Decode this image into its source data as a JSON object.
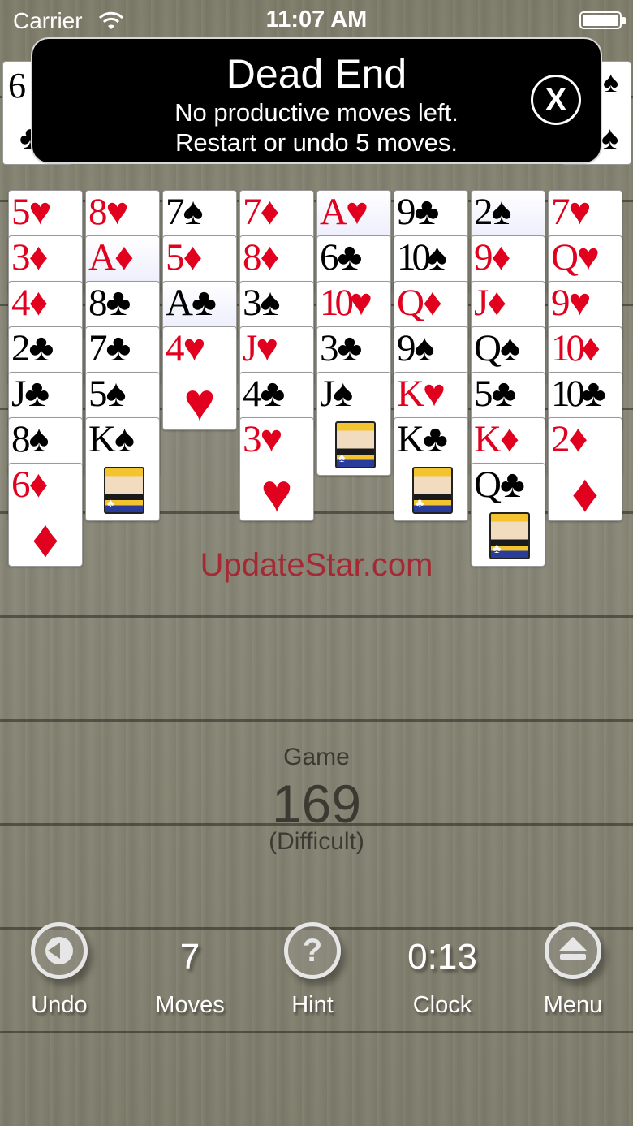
{
  "status_bar": {
    "carrier": "Carrier",
    "time": "11:07 AM"
  },
  "freecells": {
    "left": {
      "rank": "6",
      "suit": "♣",
      "color": "black"
    },
    "right": {
      "rank": "",
      "suit": "♠",
      "color": "black"
    }
  },
  "dialog": {
    "title": "Dead End",
    "line1": "No productive moves left.",
    "line2": "Restart or undo 5 moves.",
    "close_label": "X"
  },
  "tableau": [
    {
      "cards": [
        {
          "rank": "5",
          "suit": "♥",
          "color": "red"
        },
        {
          "rank": "3",
          "suit": "♦",
          "color": "red"
        },
        {
          "rank": "4",
          "suit": "♦",
          "color": "red"
        },
        {
          "rank": "2",
          "suit": "♣",
          "color": "black"
        },
        {
          "rank": "J",
          "suit": "♣",
          "color": "black"
        },
        {
          "rank": "8",
          "suit": "♠",
          "color": "black"
        },
        {
          "rank": "6",
          "suit": "♦",
          "color": "red"
        }
      ]
    },
    {
      "cards": [
        {
          "rank": "8",
          "suit": "♥",
          "color": "red"
        },
        {
          "rank": "A",
          "suit": "♦",
          "color": "red",
          "highlight": true
        },
        {
          "rank": "8",
          "suit": "♣",
          "color": "black"
        },
        {
          "rank": "7",
          "suit": "♣",
          "color": "black"
        },
        {
          "rank": "5",
          "suit": "♠",
          "color": "black"
        },
        {
          "rank": "K",
          "suit": "♠",
          "color": "black"
        }
      ]
    },
    {
      "cards": [
        {
          "rank": "7",
          "suit": "♠",
          "color": "black"
        },
        {
          "rank": "5",
          "suit": "♦",
          "color": "red"
        },
        {
          "rank": "A",
          "suit": "♣",
          "color": "black",
          "highlight": true
        },
        {
          "rank": "4",
          "suit": "♥",
          "color": "red"
        }
      ]
    },
    {
      "cards": [
        {
          "rank": "7",
          "suit": "♦",
          "color": "red"
        },
        {
          "rank": "8",
          "suit": "♦",
          "color": "red"
        },
        {
          "rank": "3",
          "suit": "♠",
          "color": "black"
        },
        {
          "rank": "J",
          "suit": "♥",
          "color": "red"
        },
        {
          "rank": "4",
          "suit": "♣",
          "color": "black"
        },
        {
          "rank": "3",
          "suit": "♥",
          "color": "red"
        }
      ]
    },
    {
      "cards": [
        {
          "rank": "A",
          "suit": "♥",
          "color": "red",
          "highlight": true
        },
        {
          "rank": "6",
          "suit": "♣",
          "color": "black"
        },
        {
          "rank": "10",
          "suit": "♥",
          "color": "red"
        },
        {
          "rank": "3",
          "suit": "♣",
          "color": "black"
        },
        {
          "rank": "J",
          "suit": "♠",
          "color": "black"
        }
      ]
    },
    {
      "cards": [
        {
          "rank": "9",
          "suit": "♣",
          "color": "black"
        },
        {
          "rank": "10",
          "suit": "♠",
          "color": "black"
        },
        {
          "rank": "Q",
          "suit": "♦",
          "color": "red"
        },
        {
          "rank": "9",
          "suit": "♠",
          "color": "black"
        },
        {
          "rank": "K",
          "suit": "♥",
          "color": "red"
        },
        {
          "rank": "K",
          "suit": "♣",
          "color": "black"
        }
      ]
    },
    {
      "cards": [
        {
          "rank": "2",
          "suit": "♠",
          "color": "black",
          "highlight": true
        },
        {
          "rank": "9",
          "suit": "♦",
          "color": "red"
        },
        {
          "rank": "J",
          "suit": "♦",
          "color": "red"
        },
        {
          "rank": "Q",
          "suit": "♠",
          "color": "black"
        },
        {
          "rank": "5",
          "suit": "♣",
          "color": "black"
        },
        {
          "rank": "K",
          "suit": "♦",
          "color": "red"
        },
        {
          "rank": "Q",
          "suit": "♣",
          "color": "black"
        }
      ]
    },
    {
      "cards": [
        {
          "rank": "7",
          "suit": "♥",
          "color": "red"
        },
        {
          "rank": "Q",
          "suit": "♥",
          "color": "red"
        },
        {
          "rank": "9",
          "suit": "♥",
          "color": "red"
        },
        {
          "rank": "10",
          "suit": "♦",
          "color": "red"
        },
        {
          "rank": "10",
          "suit": "♣",
          "color": "black"
        },
        {
          "rank": "2",
          "suit": "♦",
          "color": "red"
        }
      ]
    }
  ],
  "watermark": "UpdateStar.com",
  "game": {
    "label": "Game",
    "number": "169",
    "difficulty": "(Difficult)"
  },
  "toolbar": {
    "undo_label": "Undo",
    "moves_value": "7",
    "moves_label": "Moves",
    "hint_label": "Hint",
    "hint_icon_glyph": "?",
    "clock_value": "0:13",
    "clock_label": "Clock",
    "menu_label": "Menu"
  },
  "colors": {
    "red_suit": "#e1001d",
    "watermark": "#a8202e",
    "dialog_bg": "#000000"
  }
}
